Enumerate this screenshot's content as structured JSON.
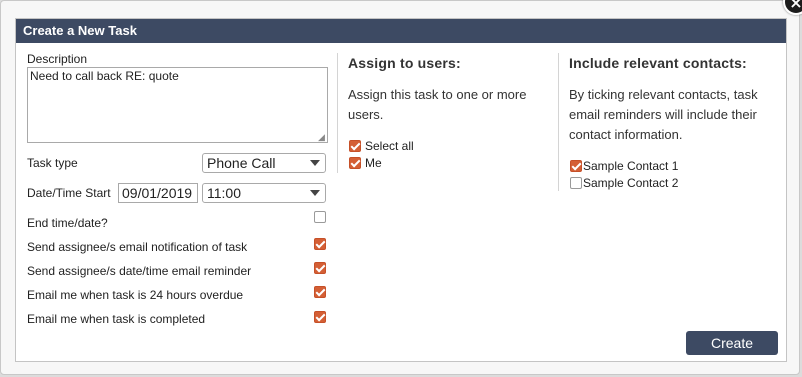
{
  "dialog": {
    "title": "Create a New Task",
    "close_glyph": "×"
  },
  "form": {
    "description_label": "Description",
    "description_value": "Need to call back RE: quote",
    "task_type_label": "Task type",
    "task_type_value": "Phone Call",
    "datetime_label": "Date/Time Start",
    "date_value": "09/01/2019",
    "time_value": "11:00",
    "options": [
      {
        "label": "End time/date?",
        "checked": false
      },
      {
        "label": "Send assignee/s email notification of task",
        "checked": true
      },
      {
        "label": "Send assignee/s date/time email reminder",
        "checked": true
      },
      {
        "label": "Email me when task is 24 hours overdue",
        "checked": true
      },
      {
        "label": "Email me when task is completed",
        "checked": true
      }
    ]
  },
  "assign": {
    "heading": "Assign to users:",
    "text": "Assign this task to one or more users.",
    "users": [
      {
        "label": "Select all",
        "checked": true
      },
      {
        "label": "Me",
        "checked": true
      }
    ]
  },
  "contacts": {
    "heading": "Include relevant contacts:",
    "text": "By ticking relevant contacts, task email reminders will include their contact information.",
    "items": [
      {
        "label": "Sample Contact 1",
        "checked": true
      },
      {
        "label": "Sample Contact 2",
        "checked": false
      }
    ]
  },
  "actions": {
    "create_label": "Create"
  },
  "colors": {
    "header_bg": "#3d4a63",
    "checkbox_accent": "#d45f35"
  }
}
